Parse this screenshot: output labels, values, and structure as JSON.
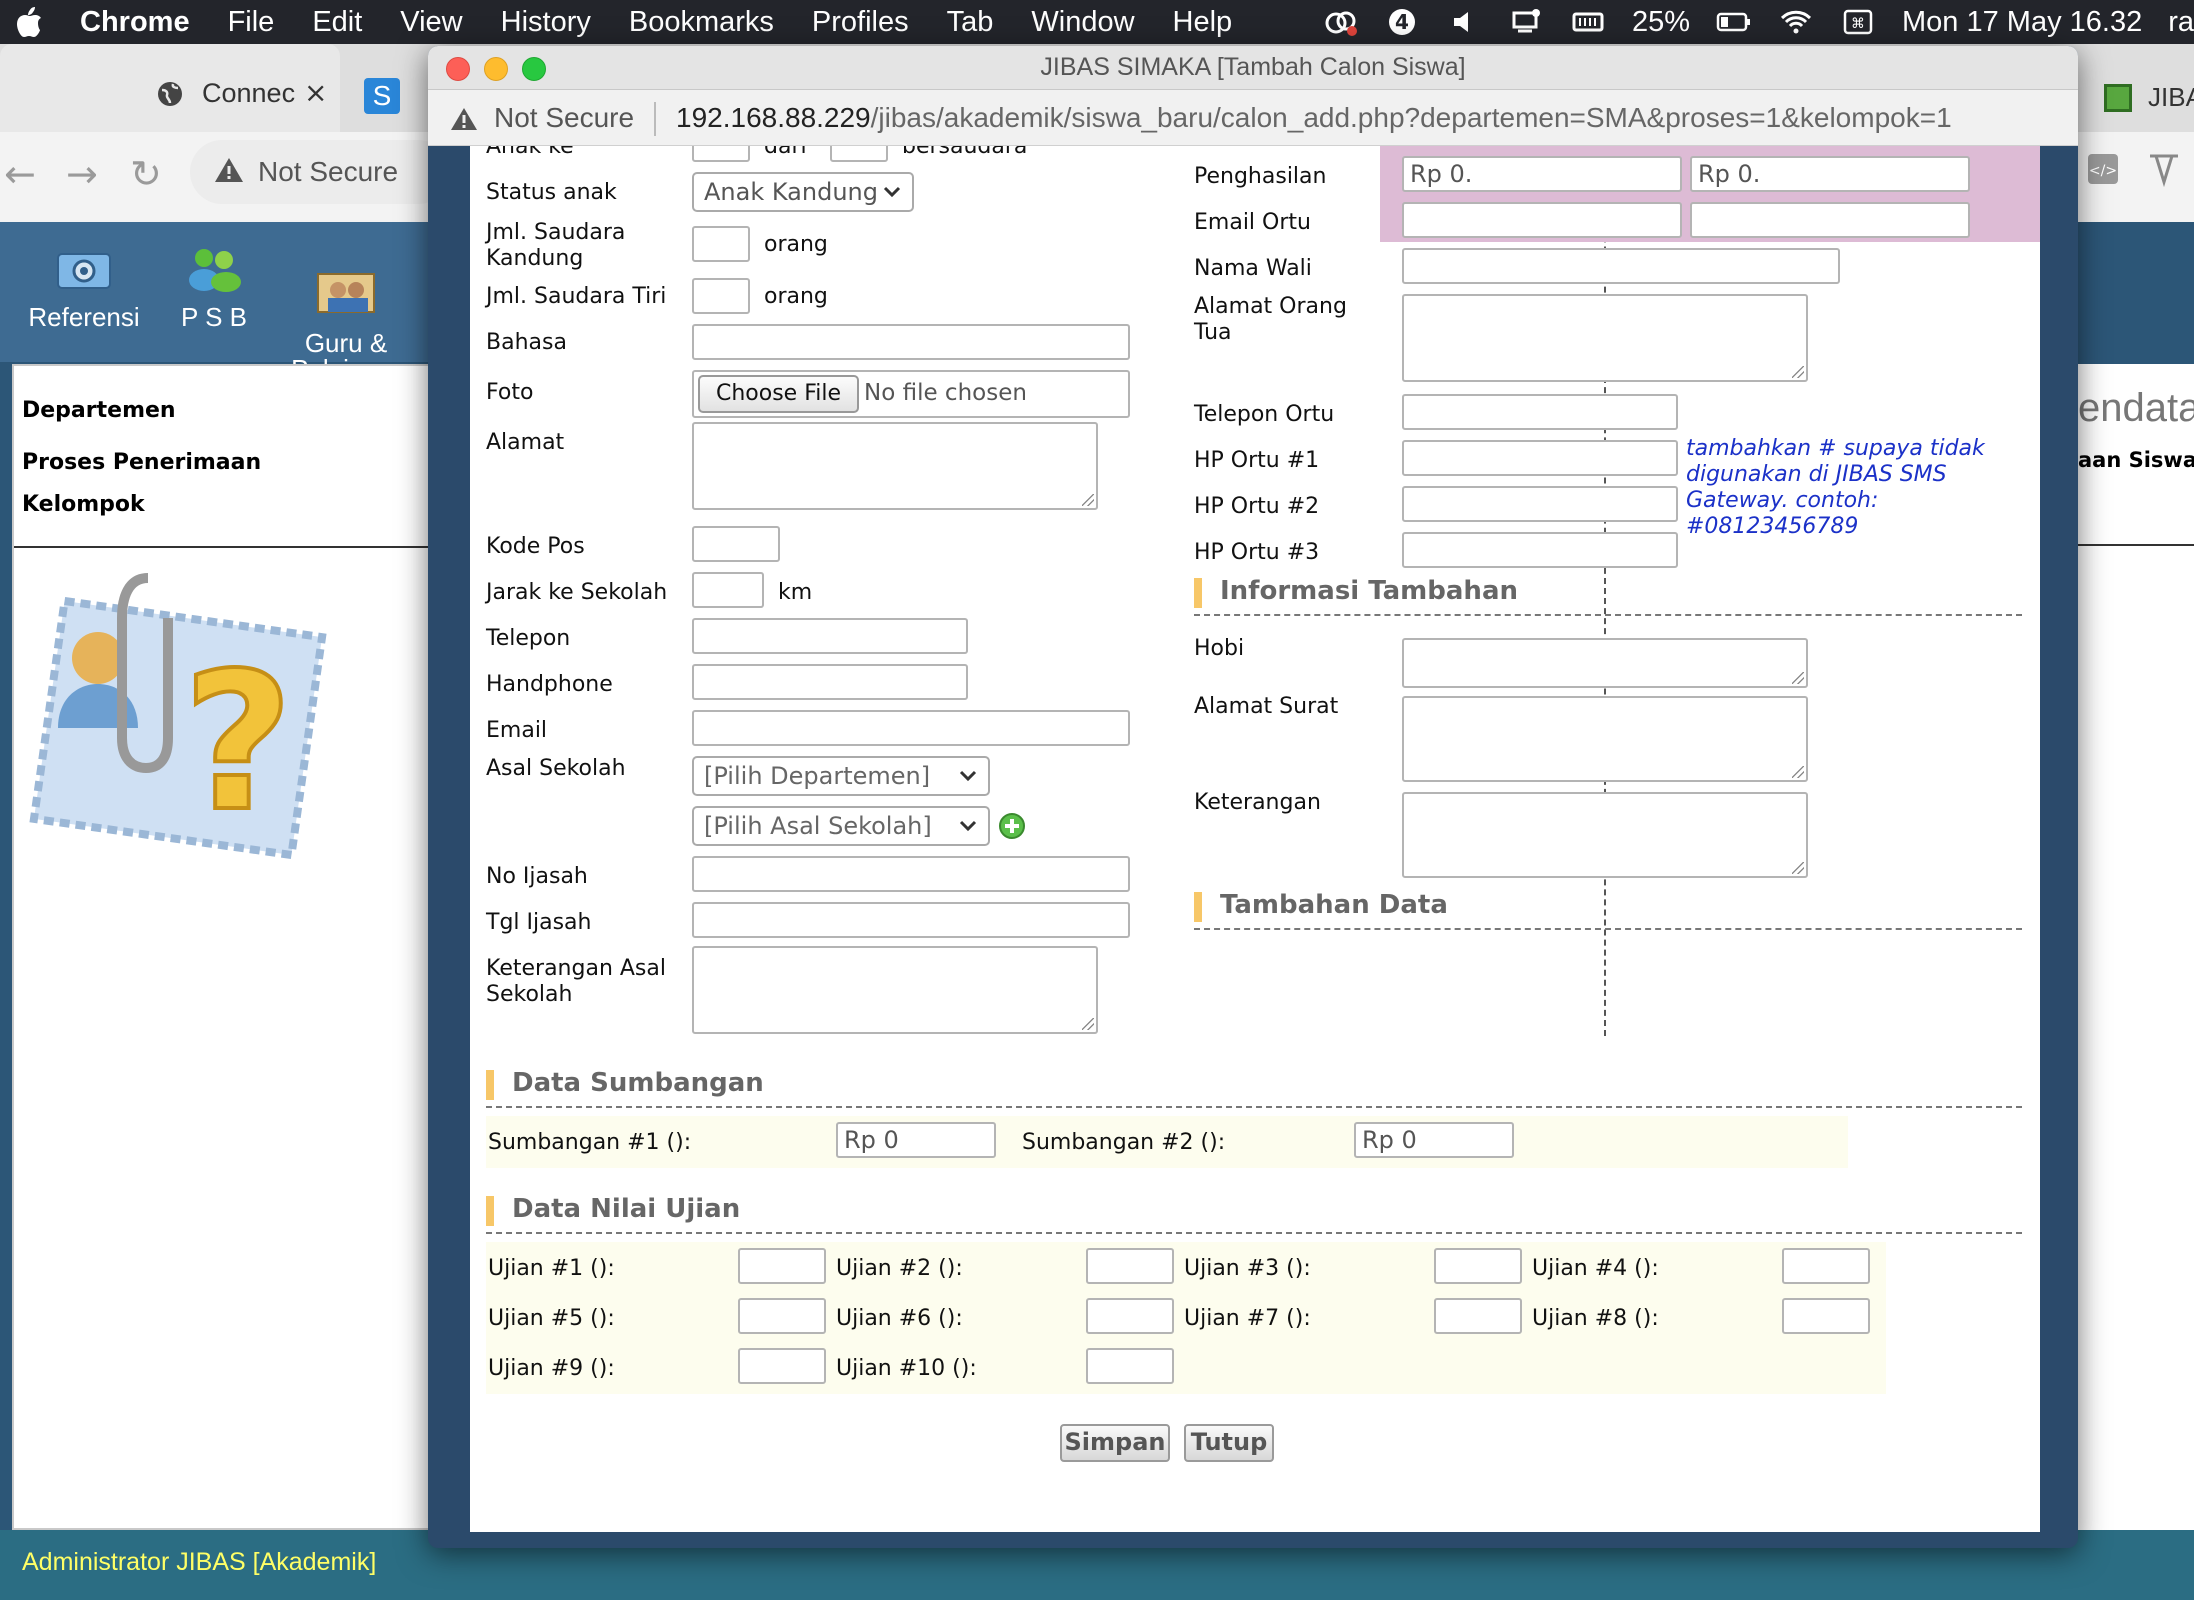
{
  "menubar": {
    "items": [
      "Chrome",
      "File",
      "Edit",
      "View",
      "History",
      "Bookmarks",
      "Profiles",
      "Tab",
      "Window",
      "Help"
    ],
    "battery": "25%",
    "clock": "Mon 17 May  16.32",
    "user": "ra"
  },
  "background_browser": {
    "tab1_label": "Connec",
    "tab1_close": "×",
    "tab2_letter": "S",
    "tab3_label": "JIBA",
    "url_status": "Not Secure",
    "nav": [
      {
        "label": "Referensi"
      },
      {
        "label": "P S B"
      },
      {
        "label": "Guru &\nPelajaran"
      }
    ],
    "panel_fields": [
      "Departemen",
      "Proses Penerimaan",
      "Kelompok"
    ],
    "right_title": "endata",
    "right_subtitle": "aan Siswa",
    "status": "Administrator JIBAS [Akademik]"
  },
  "popup": {
    "title": "JIBAS SIMAKA [Tambah Calon Siswa]",
    "url_status": "Not Secure",
    "url_host": "192.168.88.229",
    "url_path": "/jibas/akademik/siswa_baru/calon_add.php?departemen=SMA&proses=1&kelompok=1"
  },
  "form_left": {
    "anak_ke_label": "Anak ke",
    "anak_ke_mid": "dari",
    "anak_ke_end": "bersaudara",
    "status_anak_label": "Status anak",
    "status_anak_value": "Anak Kandung",
    "saudara_kandung_label": "Jml. Saudara\nKandung",
    "saudara_tiri_label": "Jml. Saudara Tiri",
    "orang": "orang",
    "bahasa_label": "Bahasa",
    "foto_label": "Foto",
    "foto_button": "Choose File",
    "foto_text": "No file chosen",
    "alamat_label": "Alamat",
    "kode_pos_label": "Kode Pos",
    "jarak_label": "Jarak ke Sekolah",
    "km": "km",
    "telepon_label": "Telepon",
    "handphone_label": "Handphone",
    "email_label": "Email",
    "asal_sekolah_label": "Asal Sekolah",
    "pilih_departemen": "[Pilih Departemen]",
    "pilih_asal_sekolah": "[Pilih Asal Sekolah]",
    "no_ijasah_label": "No Ijasah",
    "tgl_ijasah_label": "Tgl Ijasah",
    "ket_asal_label": "Keterangan Asal\nSekolah"
  },
  "form_right": {
    "penghasilan_label": "Penghasilan",
    "penghasilan_ayah": "Rp 0.",
    "penghasilan_ibu": "Rp 0.",
    "email_ortu_label": "Email Ortu",
    "nama_wali_label": "Nama Wali",
    "alamat_ortu_label": "Alamat Orang\nTua",
    "telepon_ortu_label": "Telepon Ortu",
    "hp1_label": "HP Ortu #1",
    "hp2_label": "HP Ortu #2",
    "hp3_label": "HP Ortu #3",
    "hint": "tambahkan # supaya tidak\ndigunakan di JIBAS SMS\nGateway. contoh:\n#08123456789",
    "info_tambahan": "Informasi Tambahan",
    "hobi_label": "Hobi",
    "alamat_surat_label": "Alamat Surat",
    "keterangan_label": "Keterangan",
    "tambahan_data": "Tambahan Data"
  },
  "sumbangan": {
    "title": "Data Sumbangan",
    "s1_label": "Sumbangan #1 ():",
    "s1_value": "Rp 0",
    "s2_label": "Sumbangan #2 ():",
    "s2_value": "Rp 0"
  },
  "ujian": {
    "title": "Data Nilai Ujian",
    "labels": [
      "Ujian #1 ():",
      "Ujian #2 ():",
      "Ujian #3 ():",
      "Ujian #4 ():",
      "Ujian #5 ():",
      "Ujian #6 ():",
      "Ujian #7 ():",
      "Ujian #8 ():",
      "Ujian #9 ():",
      "Ujian #10 ():"
    ]
  },
  "buttons": {
    "simpan": "Simpan",
    "tutup": "Tutup"
  }
}
